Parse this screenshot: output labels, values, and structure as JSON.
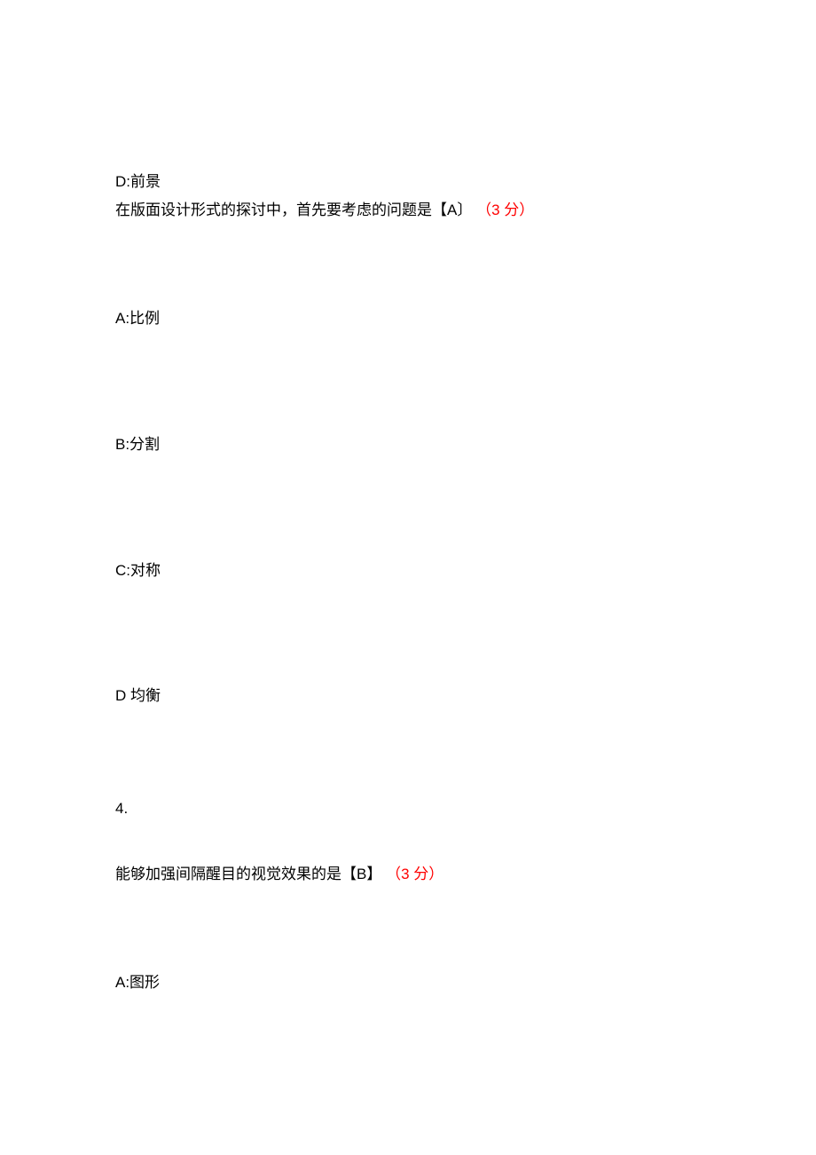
{
  "q3": {
    "option_d_prev": "D:前景",
    "question_prefix": "在版面设计形式的探讨中，首先要考虑的问题是【A〕",
    "score": "（3 分）",
    "options": {
      "a": "A:比例",
      "b": "B:分割",
      "c": "C:对称",
      "d": "D 均衡"
    }
  },
  "q4": {
    "number": "4.",
    "question_prefix": "能够加强间隔醒目的视觉效果的是【B】",
    "score": "（3 分）",
    "options": {
      "a": "A:图形"
    }
  }
}
